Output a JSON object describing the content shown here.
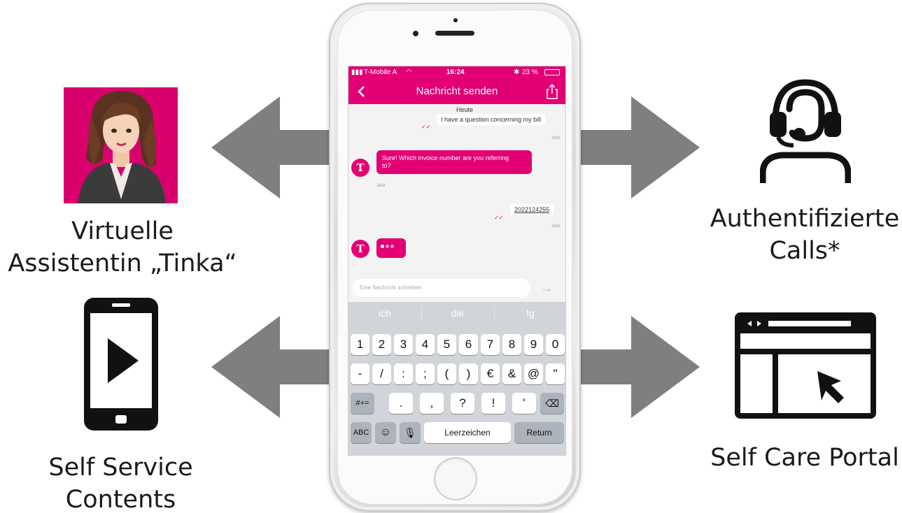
{
  "labels": {
    "left_top": [
      "Virtuelle",
      "Assistentin „Tinka“"
    ],
    "left_bottom": [
      "Self Service",
      "Contents"
    ],
    "right_top": [
      "Authentifizierte",
      "Calls*"
    ],
    "right_bottom": "Self Care Portal"
  },
  "icons": {
    "left_top": "avatar-illustration",
    "left_bottom": "smartphone-play-icon",
    "right_top": "headset-agent-icon",
    "right_bottom": "browser-window-cursor-icon"
  },
  "colors": {
    "brand": "#e20074",
    "arrow": "#7f7f7f"
  },
  "phone": {
    "statusbar": {
      "carrier": "T-Mobile A",
      "time": "16:24",
      "battery": "23 %"
    },
    "navbar": {
      "title": "Nachricht senden"
    },
    "chat": {
      "day": "Heute",
      "messages": [
        {
          "from": "user",
          "text": "I have a question concerning my bill",
          "time": "Jetzt"
        },
        {
          "from": "bot",
          "text_line1": "Sure! Which invoice number are you referring",
          "text_line2": "to?",
          "time": "Jetzt"
        },
        {
          "from": "user",
          "text": "2022124255",
          "time": "Jetzt"
        },
        {
          "from": "bot",
          "text": "typing"
        }
      ]
    },
    "input_placeholder": "Eine Nachricht schreiben",
    "keyboard": {
      "suggestions": [
        "ich",
        "die",
        "Ig"
      ],
      "row1": [
        "1",
        "2",
        "3",
        "4",
        "5",
        "6",
        "7",
        "8",
        "9",
        "0"
      ],
      "row2": [
        "-",
        "/",
        ":",
        ";",
        "(",
        ")",
        "€",
        "&",
        "@",
        "\""
      ],
      "row3_left": "#+=",
      "row3": [
        ".",
        ",",
        "?",
        "!",
        "'"
      ],
      "row4": {
        "abc": "ABC",
        "space": "Leerzeichen",
        "return": "Return"
      }
    }
  }
}
